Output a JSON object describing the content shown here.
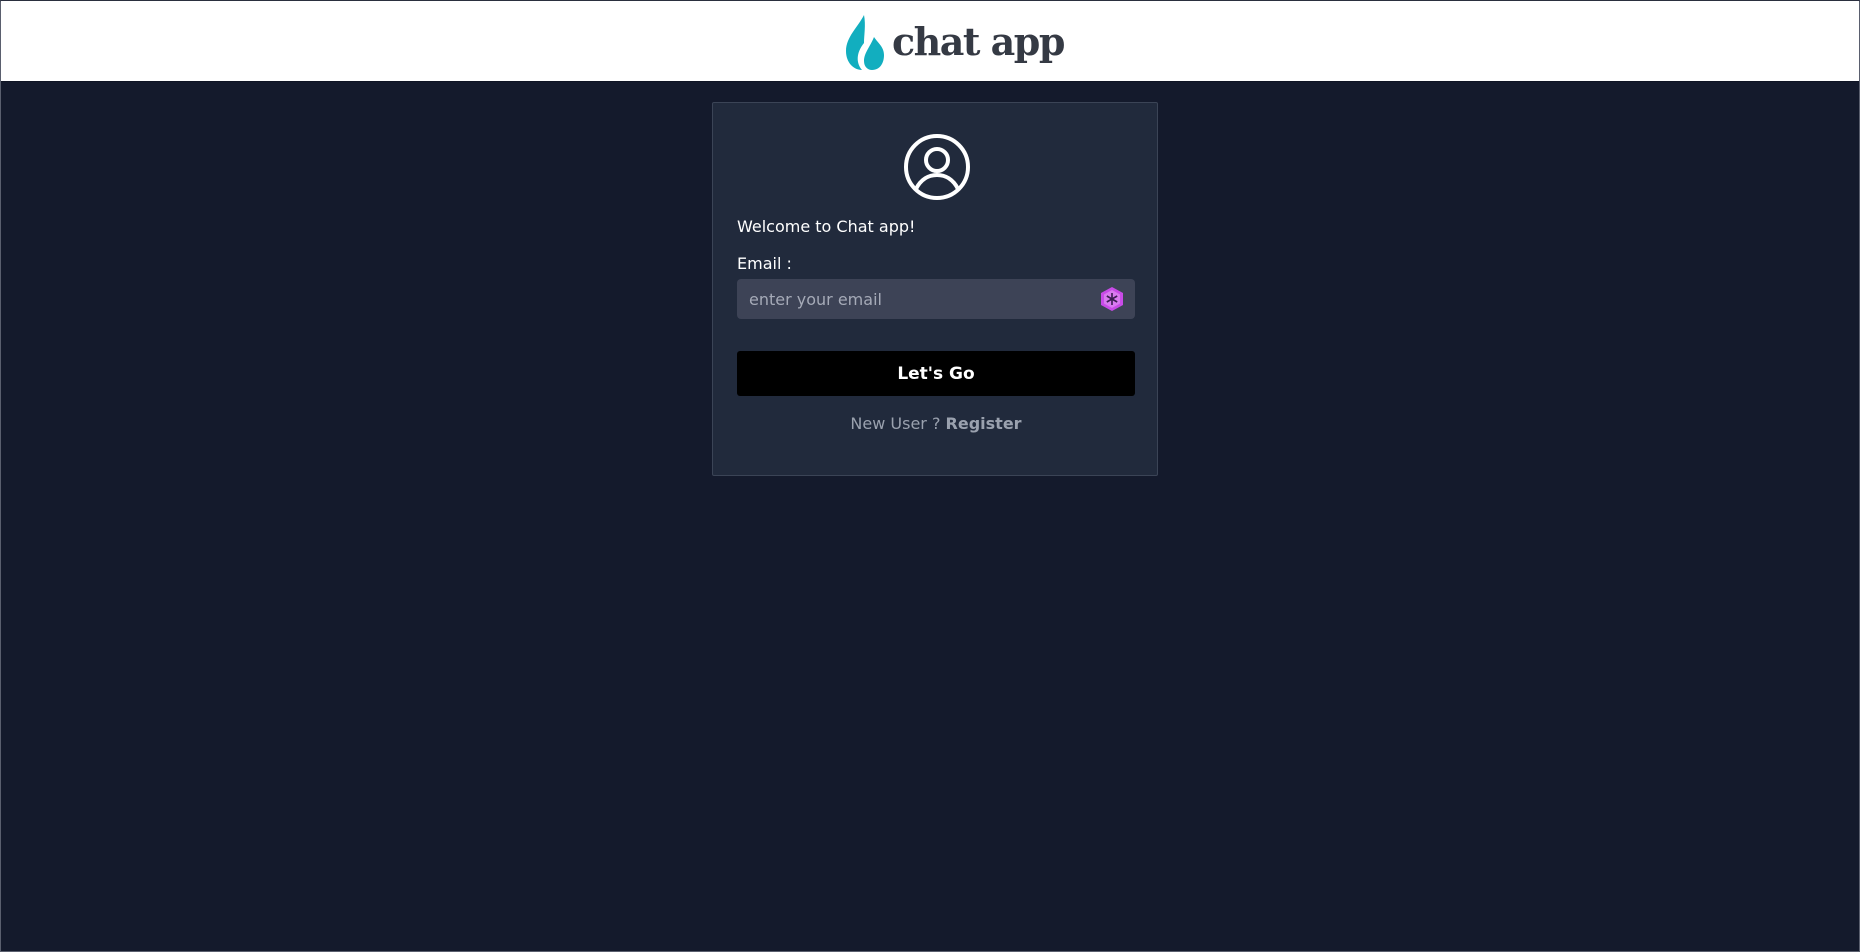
{
  "header": {
    "logo_text": "chat app",
    "logo_color": "#12aebf"
  },
  "login": {
    "welcome": "Welcome to Chat app!",
    "email_label": "Email :",
    "email_placeholder": "enter your email",
    "email_value": "",
    "submit_label": "Let's Go",
    "register_prompt": "New User ?",
    "register_link": "Register"
  },
  "icons": {
    "avatar": "user-circle-icon",
    "extension": "password-manager-icon"
  },
  "colors": {
    "background": "#141a2c",
    "card": "#212a3c",
    "input": "#3d4356",
    "button": "#000000",
    "extension_icon": "#c94be8"
  }
}
